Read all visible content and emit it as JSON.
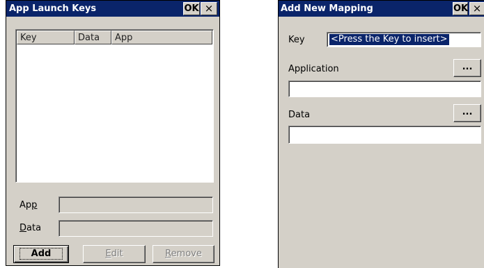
{
  "launch_window": {
    "title": "App Launch Keys",
    "ok_label": "OK",
    "close_glyph": "×",
    "columns": [
      "Key",
      "Data",
      "App"
    ],
    "rows": [],
    "app_label_pre": "Ap",
    "app_label_ul": "p",
    "data_label_ul": "D",
    "data_label_post": "ata",
    "app_value": "",
    "data_value": "",
    "add_label": "Add",
    "edit_label_ul": "E",
    "edit_label_post": "dit",
    "remove_label_ul": "R",
    "remove_label_post": "emove"
  },
  "mapping_window": {
    "title": "Add New Mapping",
    "ok_label": "OK",
    "close_glyph": "×",
    "key_label": "Key",
    "key_value": "<Press the Key to insert>",
    "application_label": "Application",
    "application_value": "",
    "browse_label": "...",
    "data_label": "Data",
    "data_value": ""
  }
}
